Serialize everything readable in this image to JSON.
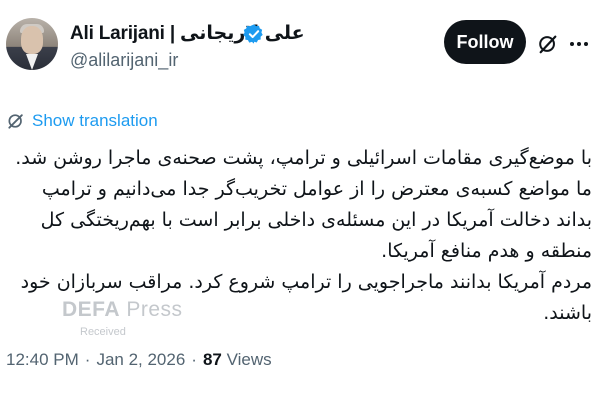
{
  "author": {
    "display_name": "Ali Larijani | علی لاریجانی",
    "handle": "@alilarijani_ir",
    "verified": true
  },
  "actions": {
    "follow_label": "Follow"
  },
  "translation": {
    "label": "Show translation"
  },
  "tweet": {
    "paragraphs": [
      "با موضع‌گیری مقامات اسرائیلی و ترامپ، پشت صحنه‌ی ماجرا روشن شد. ما مواضع کسبه‌ی معترض را از عوامل تخریب‌گر جدا می‌دانیم و ترامپ بداند دخالت آمریکا در این مسئله‌ی داخلی برابر است با بهم‌ریختگی کل منطقه و هدم منافع آمریکا.",
      "مردم آمریکا بدانند ماجراجویی را ترامپ شروع کرد. مراقب سربازان خود باشند."
    ]
  },
  "watermark": {
    "brand_bold": "DEFA",
    "brand_light": " Press",
    "sub": "Received"
  },
  "meta": {
    "time": "12:40 PM",
    "date": "Jan 2, 2026",
    "views_count": "87",
    "views_label": "Views"
  },
  "colors": {
    "verified_badge": "#1d9bf0",
    "link": "#1d9bf0",
    "follow_bg": "#0f1419",
    "secondary_text": "#536471"
  },
  "icons": [
    "verified-badge-icon",
    "grok-icon",
    "more-icon",
    "translate-icon"
  ]
}
